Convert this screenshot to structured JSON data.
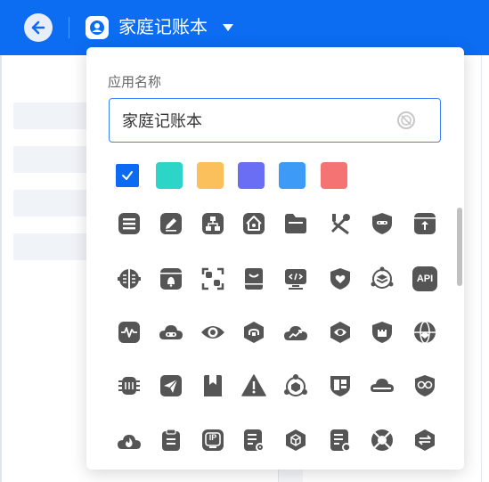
{
  "header": {
    "app_title": "家庭记账本",
    "back_icon": "arrow-left-icon",
    "app_icon": "user-badge-icon",
    "caret_icon": "caret-down-icon",
    "color": "#0c6cf2"
  },
  "popover": {
    "field_label": "应用名称",
    "name_value": "家庭记账本",
    "clear_icon": "clear-circle-icon",
    "colors": [
      {
        "name": "blue",
        "hex": "#0b6bf2",
        "selected": true
      },
      {
        "name": "teal",
        "hex": "#2dd4c8",
        "selected": false
      },
      {
        "name": "orange",
        "hex": "#fbbf5c",
        "selected": false
      },
      {
        "name": "indigo",
        "hex": "#6a6ef5",
        "selected": false
      },
      {
        "name": "sky",
        "hex": "#3d9bf7",
        "selected": false
      },
      {
        "name": "red",
        "hex": "#f57373",
        "selected": false
      }
    ],
    "icon_color": "#555555",
    "icons": [
      [
        "document-icon",
        "edit-icon",
        "org-chart-icon",
        "home-icon",
        "folder-icon",
        "tools-icon",
        "shield-badge-icon",
        "upload-box-icon"
      ],
      [
        "brain-icon",
        "notification-window-icon",
        "scan-frame-icon",
        "inbox-icon",
        "code-monitor-icon",
        "heart-shield-icon",
        "layers-circle-icon",
        "api-icon"
      ],
      [
        "pulse-monitor-icon",
        "cloud-robot-icon",
        "eye-icon",
        "hexagon-icon",
        "cloud-trend-icon",
        "eye-shield-icon",
        "castle-shield-icon",
        "globe-icon"
      ],
      [
        "chip-icon",
        "send-icon",
        "bookmark-icon",
        "warning-icon",
        "network-circle-icon",
        "dashboard-shield-icon",
        "cloud-bar-icon",
        "glasses-badge-icon"
      ],
      [
        "fire-cloud-icon",
        "clipboard-icon",
        "ip-icon",
        "report-settings-icon",
        "cube-icon",
        "document-gear-icon",
        "lifebuoy-icon",
        "transfer-hexagon-icon"
      ]
    ],
    "api_text": "API",
    "ip_text": "IP"
  }
}
